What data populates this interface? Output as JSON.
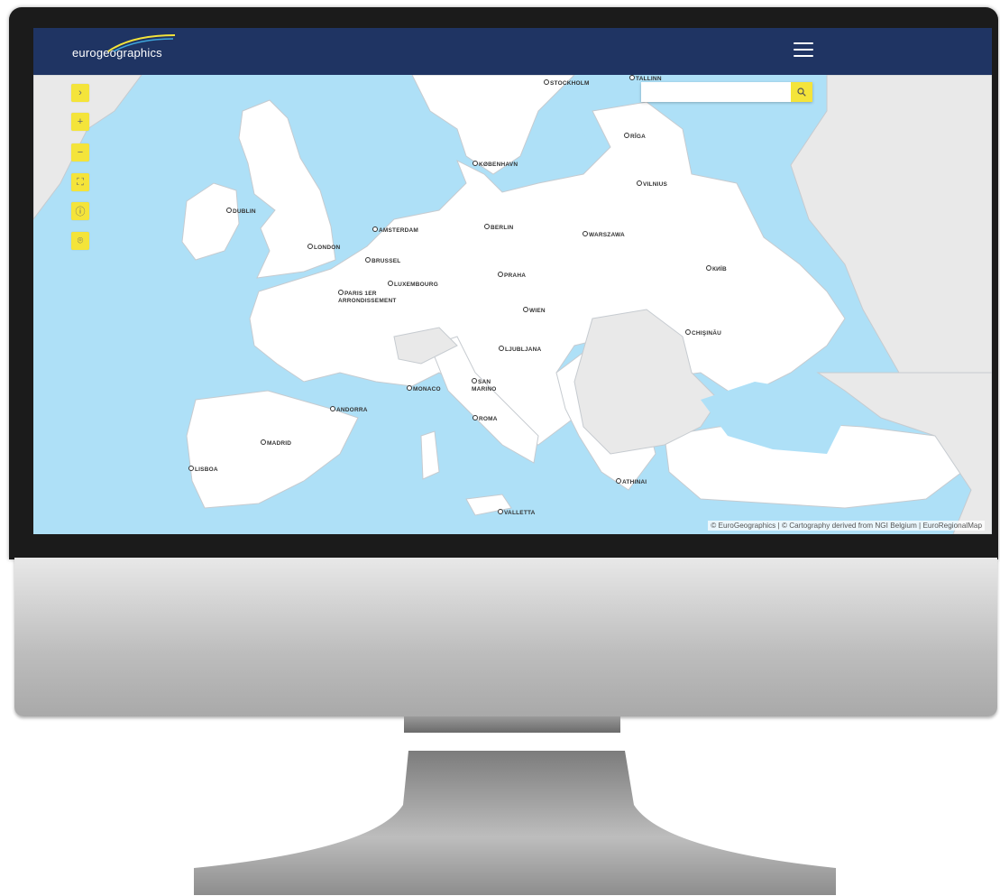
{
  "app": {
    "logo_text": "eurogeographics",
    "menu_icon": "hamburger-menu-icon"
  },
  "controls": [
    {
      "name": "expand-panel-button",
      "icon": "chevron-right-icon",
      "glyph": "›"
    },
    {
      "name": "zoom-in-button",
      "icon": "plus-icon",
      "glyph": "+"
    },
    {
      "name": "zoom-out-button",
      "icon": "minus-icon",
      "glyph": "−"
    },
    {
      "name": "fullscreen-button",
      "icon": "fullscreen-icon",
      "glyph": "⛶"
    },
    {
      "name": "info-button",
      "icon": "info-icon",
      "glyph": "ⓘ"
    },
    {
      "name": "locate-button",
      "icon": "location-pin-icon",
      "glyph": "⌾"
    }
  ],
  "search": {
    "value": "",
    "placeholder": "",
    "button_icon": "search-icon"
  },
  "cities": [
    "STOCKHOLM",
    "TALLINN",
    "RĪGA",
    "KØBENHAVN",
    "VILNIUS",
    "DUBLIN",
    "AMSTERDAM",
    "BERLIN",
    "WARSZAWA",
    "LONDON",
    "BRUSSEL",
    "КИЇВ",
    "PRAHA",
    "PARIS 1ER ARRONDISSEMENT",
    "LUXEMBOURG",
    "WIEN",
    "CHIŞINĂU",
    "LJUBLJANA",
    "SAN MARINO",
    "MONACO",
    "ANDORRA",
    "ROMA",
    "MADRID",
    "LISBOA",
    "ATHINAI",
    "VALLETTA"
  ],
  "attribution": "© EuroGeographics | © Cartography derived from NGI Belgium | EuroRegionalMap",
  "colors": {
    "navbar": "#1f3463",
    "sea": "#aee0f7",
    "land": "#ffffff",
    "non_member_land": "#e9e9e9",
    "control_accent": "#f4e43a"
  }
}
